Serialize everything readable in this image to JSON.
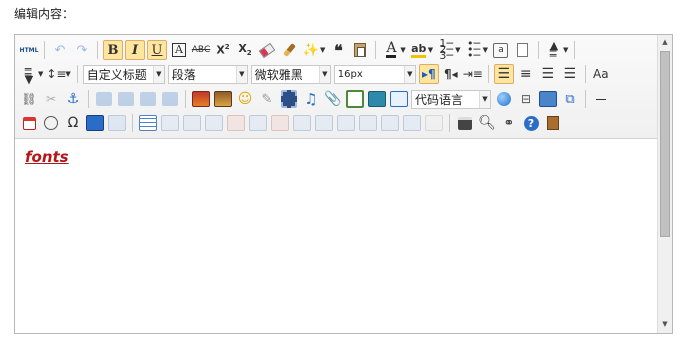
{
  "page": {
    "label": "编辑内容："
  },
  "toolbar": {
    "source_label": "HTML",
    "custom_heading": "自定义标题",
    "paragraph": "段落",
    "font_family": "微软雅黑",
    "font_size": "16px",
    "code_language": "代码语言"
  },
  "editor": {
    "content_text": "fonts",
    "content_color": "#b5161a"
  }
}
